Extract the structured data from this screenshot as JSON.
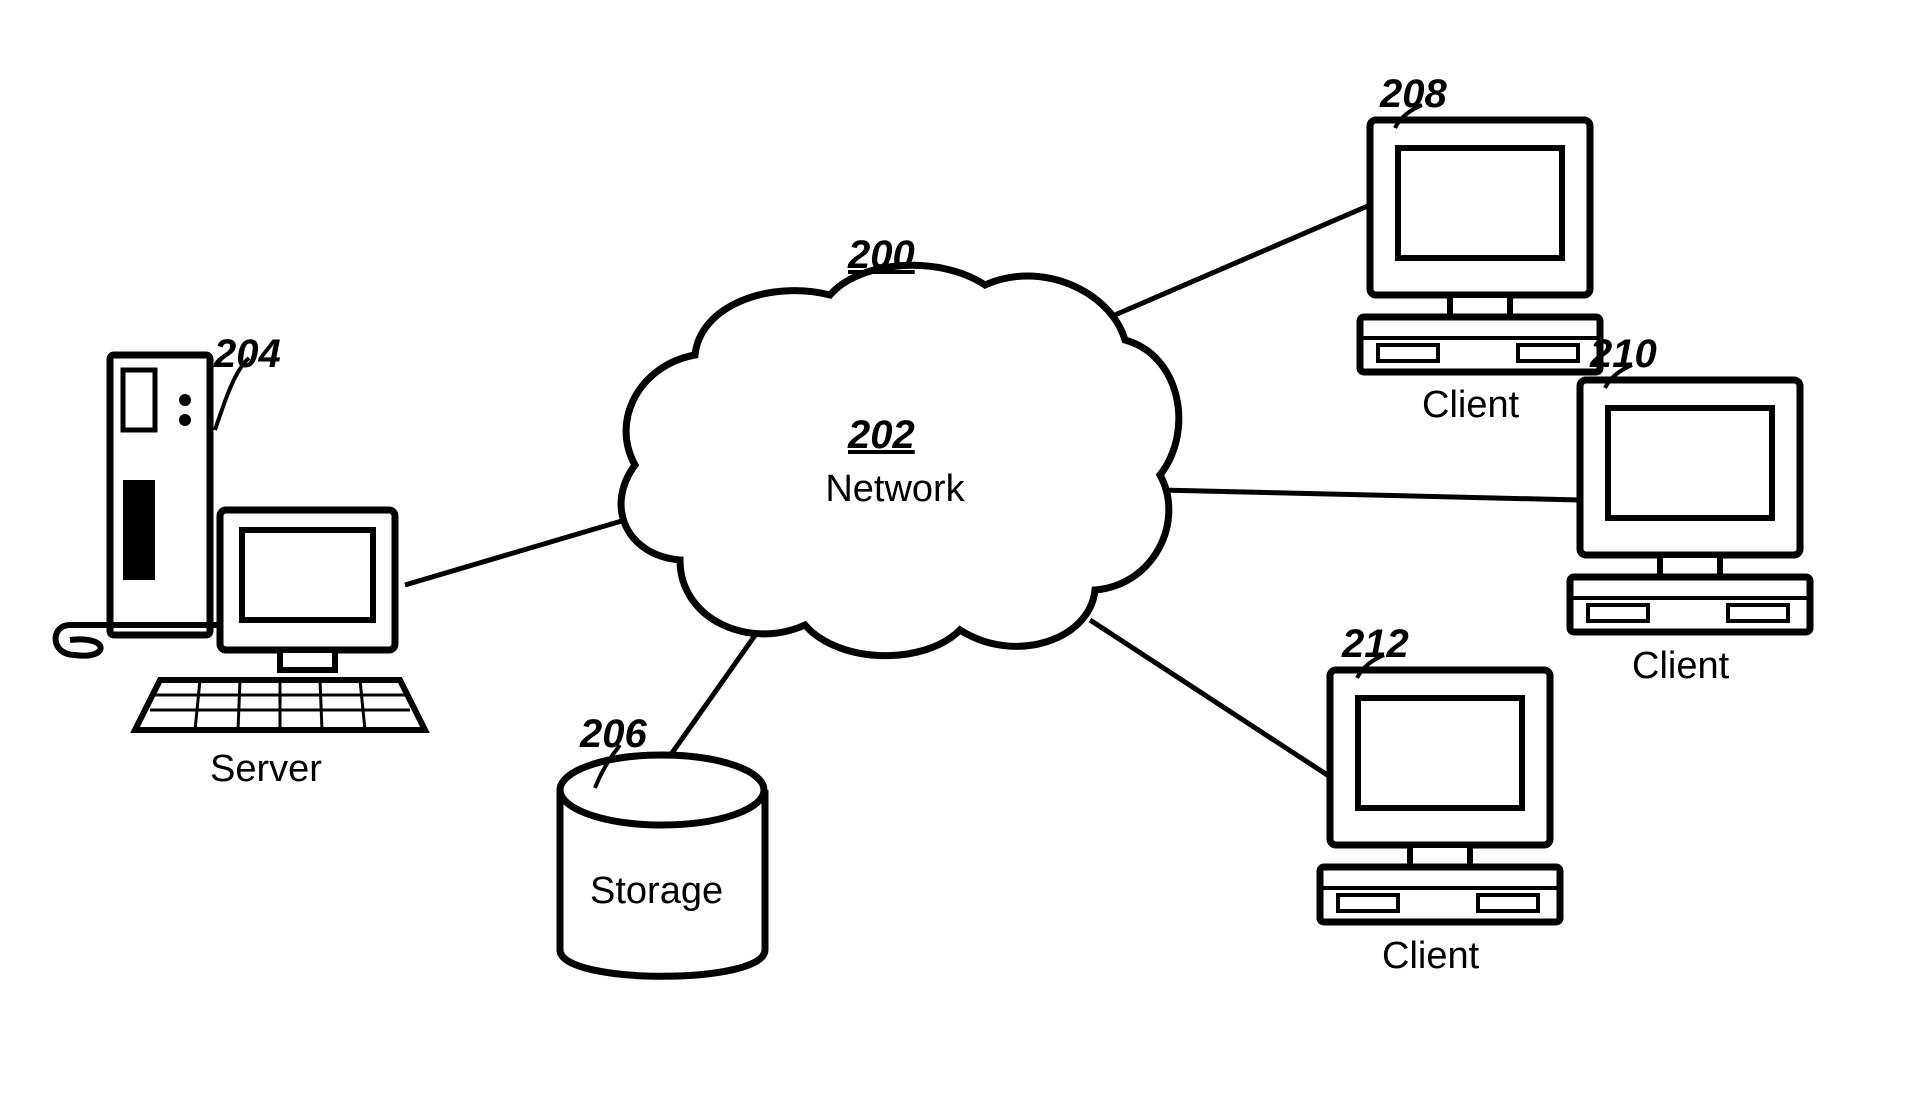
{
  "diagram": {
    "title_ref": "200",
    "cloud": {
      "ref": "202",
      "label": "Network"
    },
    "server": {
      "ref": "204",
      "label": "Server"
    },
    "storage": {
      "ref": "206",
      "label": "Storage"
    },
    "client1": {
      "ref": "208",
      "label": "Client"
    },
    "client2": {
      "ref": "210",
      "label": "Client"
    },
    "client3": {
      "ref": "212",
      "label": "Client"
    }
  }
}
